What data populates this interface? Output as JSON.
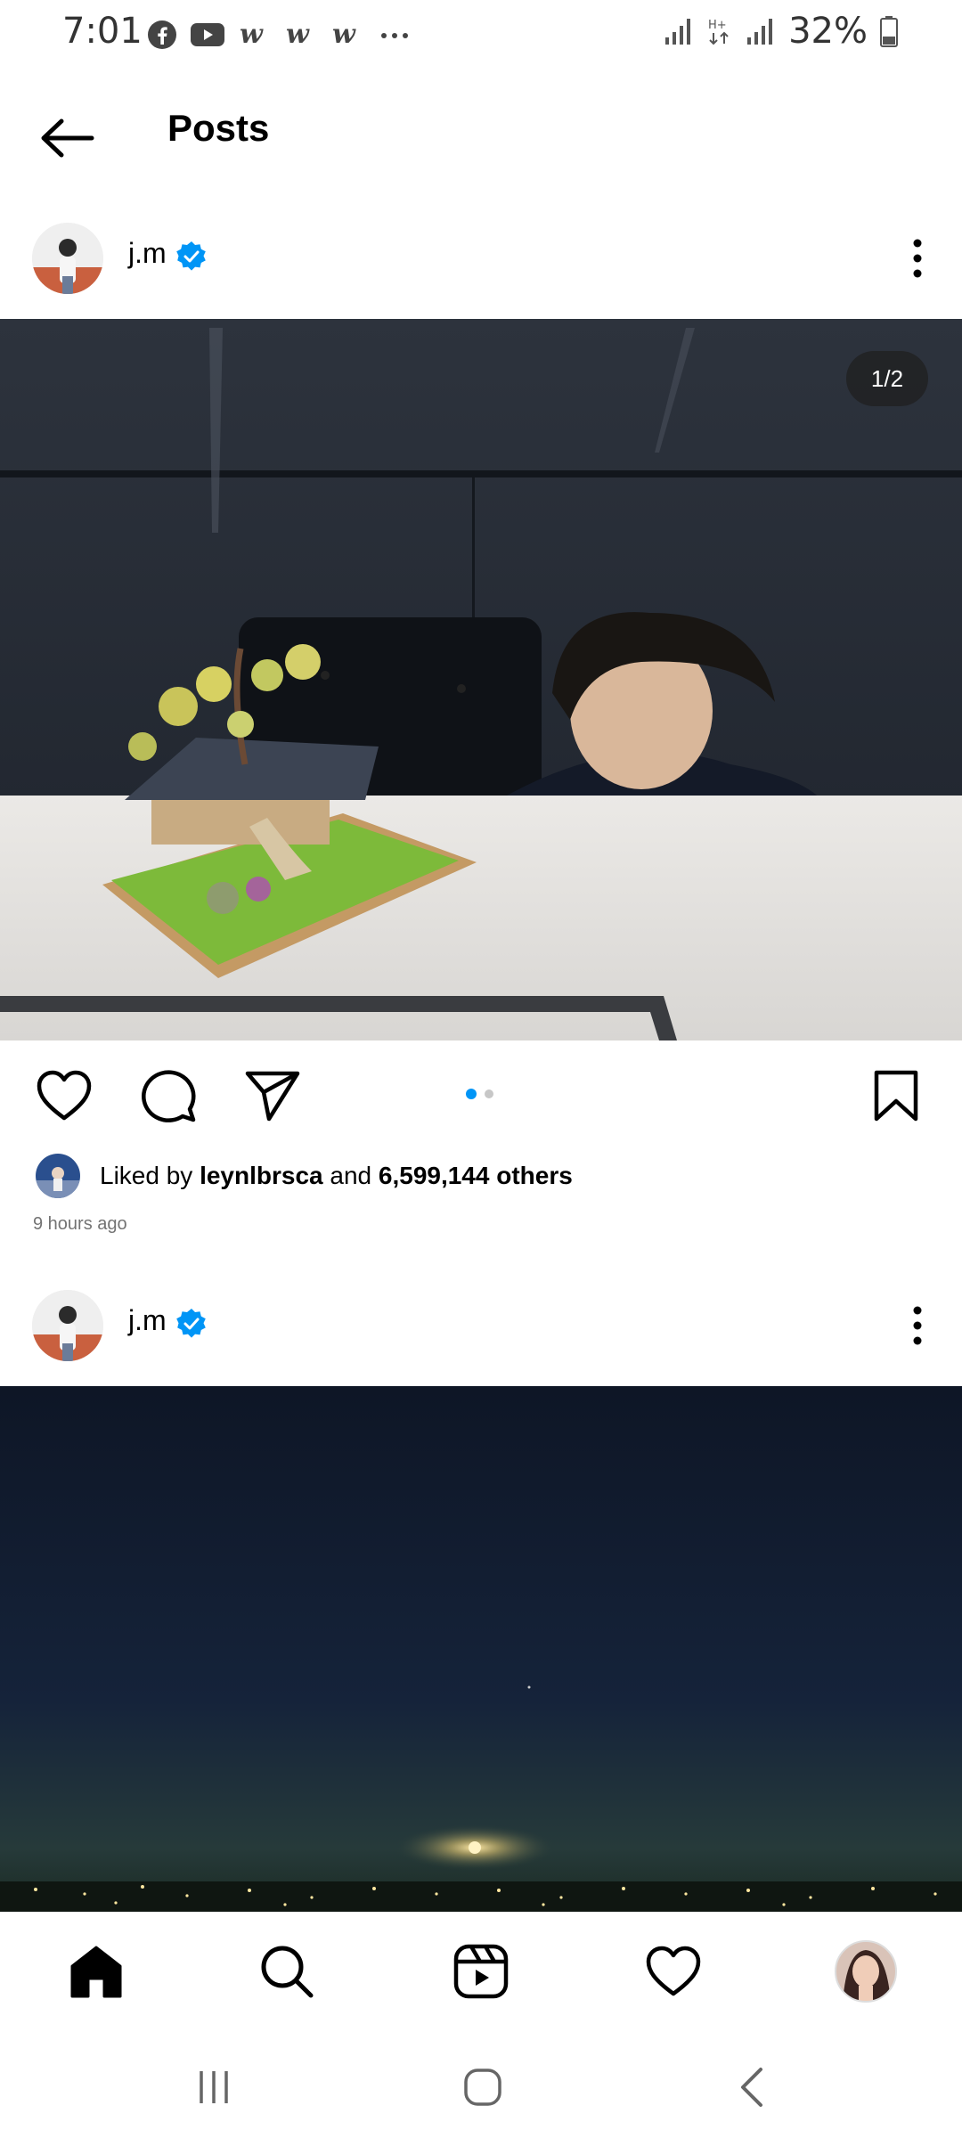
{
  "status_bar": {
    "time": "7:01",
    "battery": "32%",
    "app_icons": [
      "facebook-icon",
      "youtube-icon",
      "webtoon-icon",
      "webtoon-icon",
      "webtoon-icon",
      "more-icon"
    ]
  },
  "header": {
    "title": "Posts"
  },
  "posts": [
    {
      "username": "j.m",
      "verified": true,
      "page_indicator": "1/2",
      "carousel_pages": 2,
      "carousel_active": 1,
      "likes": {
        "prefix": "Liked by",
        "user": "leynlbrsca",
        "middle": "and",
        "count": "6,599,144 others"
      },
      "time_ago": "9 hours ago"
    },
    {
      "username": "j.m",
      "verified": true
    }
  ],
  "colors": {
    "accent_blue": "#3897f0",
    "verified_blue": "#0095f6",
    "text_secondary": "#737373"
  },
  "bottom_nav": [
    "home-icon",
    "search-icon",
    "reels-icon",
    "heart-icon",
    "profile-avatar"
  ],
  "system_nav": [
    "recent-apps-icon",
    "home-circle-icon",
    "back-chevron-icon"
  ]
}
